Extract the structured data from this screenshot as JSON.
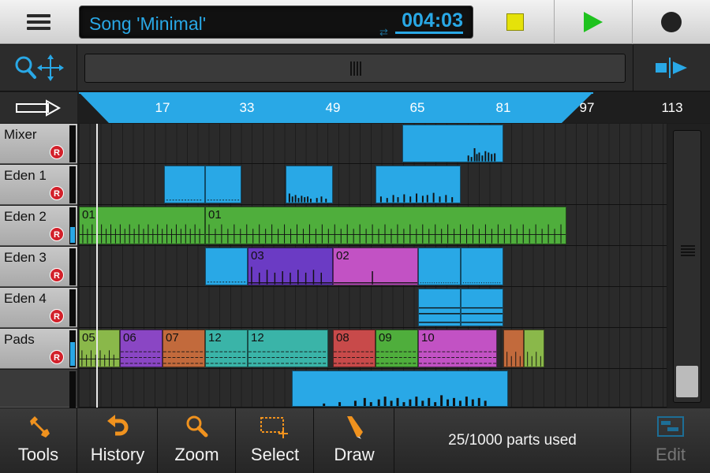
{
  "header": {
    "song_title": "Song 'Minimal'",
    "time": "004:03"
  },
  "colors": {
    "accent": "#29a8e6",
    "play": "#1fc21f",
    "stop": "#e5e20a",
    "record": "#d2202a"
  },
  "ruler": {
    "ticks": [
      "17",
      "33",
      "49",
      "65",
      "81",
      "97",
      "113"
    ]
  },
  "tracks": [
    {
      "name": "Mixer",
      "rec": "R"
    },
    {
      "name": "Eden 1",
      "rec": "R"
    },
    {
      "name": "Eden 2",
      "rec": "R"
    },
    {
      "name": "Eden 3",
      "rec": "R"
    },
    {
      "name": "Eden 4",
      "rec": "R"
    },
    {
      "name": "Pads",
      "rec": "R"
    }
  ],
  "parts": {
    "eden2": [
      "01",
      "01"
    ],
    "eden3": [
      "03",
      "02"
    ],
    "pads": [
      "05",
      "06",
      "07",
      "12",
      "12",
      "08",
      "09",
      "10"
    ]
  },
  "bottom": {
    "tools": "Tools",
    "history": "History",
    "zoom": "Zoom",
    "select": "Select",
    "draw": "Draw",
    "parts_used": "25/1000 parts used",
    "edit": "Edit"
  },
  "icons": [
    "menu-icon",
    "stop-icon",
    "play-icon",
    "record-icon",
    "zoom-pan-icon",
    "split-icon",
    "follow-icon",
    "wrench-icon",
    "undo-icon",
    "magnifier-icon",
    "select-rect-icon",
    "pencil-icon",
    "edit-window-icon"
  ]
}
